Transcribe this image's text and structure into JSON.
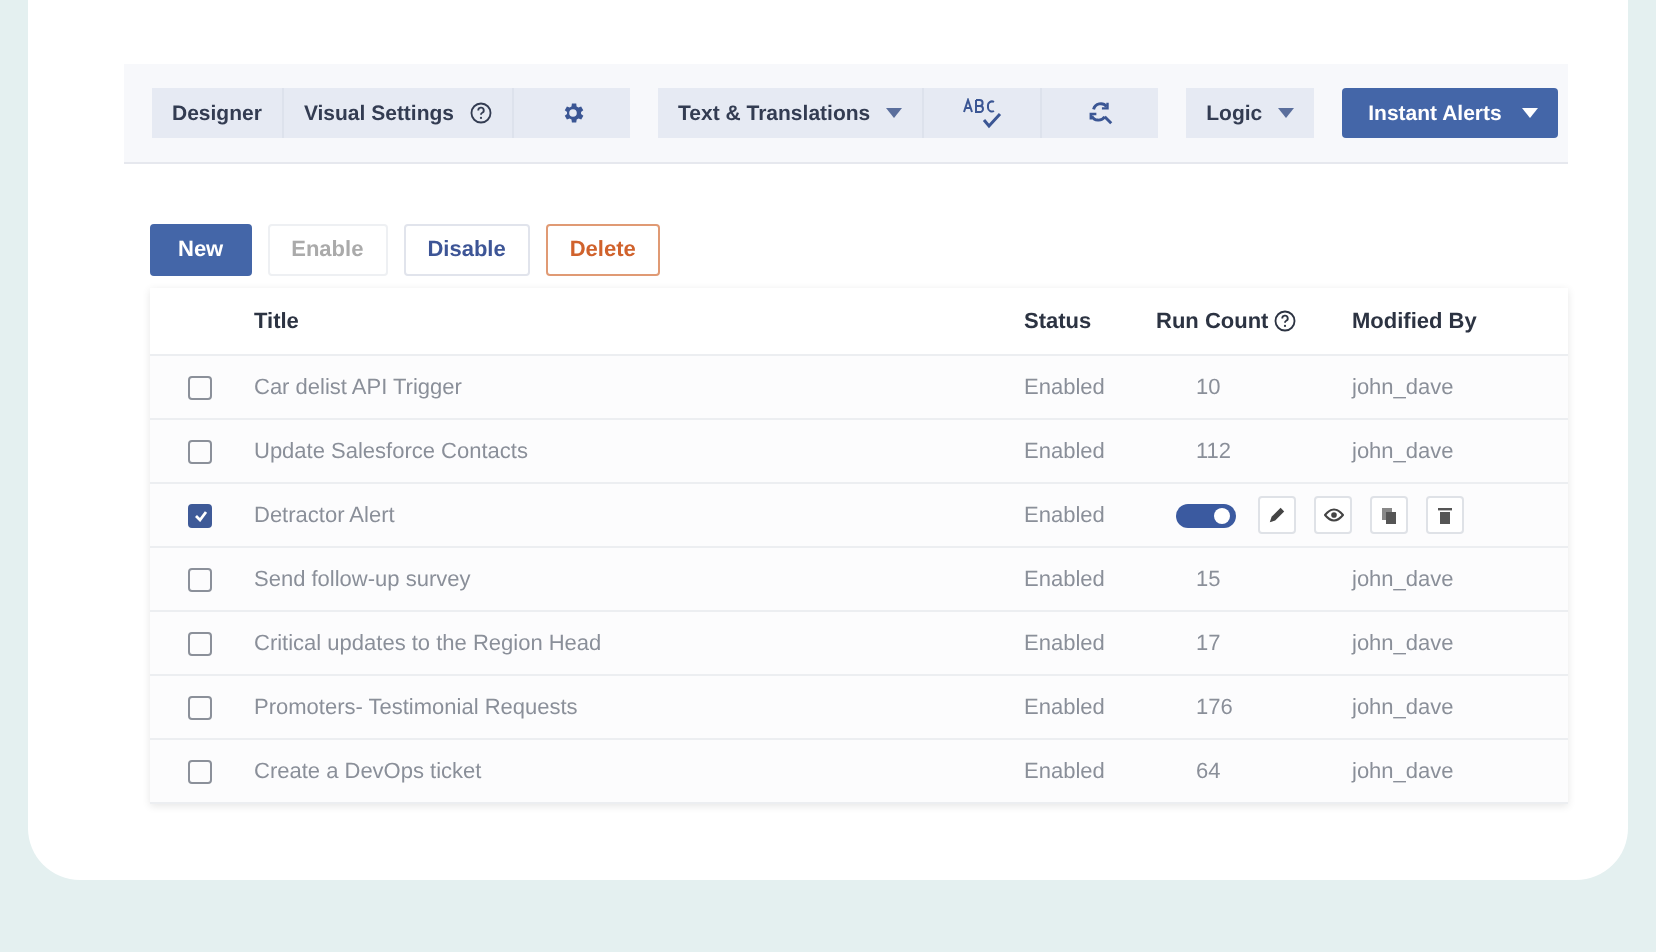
{
  "toolbar": {
    "groups": [
      {
        "items": [
          {
            "label": "Designer",
            "kind": "text"
          },
          {
            "label": "Visual Settings",
            "kind": "help"
          },
          {
            "kind": "gear"
          }
        ]
      },
      {
        "items": [
          {
            "label": "Text & Translations",
            "kind": "dropdown"
          },
          {
            "kind": "spellcheck"
          },
          {
            "kind": "find"
          }
        ]
      },
      {
        "items": [
          {
            "label": "Logic",
            "kind": "dropdown"
          }
        ]
      },
      {
        "items": [
          {
            "label": "Instant Alerts",
            "kind": "primary-dropdown"
          }
        ]
      }
    ]
  },
  "actions": [
    {
      "label": "New",
      "kind": "primary",
      "disabled": false
    },
    {
      "label": "Enable",
      "kind": "plain",
      "disabled": true
    },
    {
      "label": "Disable",
      "kind": "plain",
      "disabled": false
    },
    {
      "label": "Delete",
      "kind": "danger",
      "disabled": false
    }
  ],
  "table": {
    "columns": [
      {
        "label": "Title",
        "help": false
      },
      {
        "label": "Status",
        "help": false
      },
      {
        "label": "Run Count",
        "help": true
      },
      {
        "label": "Modified By",
        "help": false
      }
    ],
    "rows": [
      {
        "title": "Car delist API Trigger",
        "status": "Enabled",
        "run_count": "10",
        "modified_by": "john_dave",
        "checked": false,
        "kind": "plain"
      },
      {
        "title": "Update Salesforce Contacts",
        "status": "Enabled",
        "run_count": "112",
        "modified_by": "john_dave",
        "checked": false,
        "kind": "plain"
      },
      {
        "title": "Detractor Alert",
        "status": "Enabled",
        "checked": true,
        "kind": "actions",
        "toggle_on": true
      },
      {
        "title": "Send follow-up survey",
        "status": "Enabled",
        "run_count": "15",
        "modified_by": "john_dave",
        "checked": false,
        "kind": "plain"
      },
      {
        "title": "Critical updates to the Region Head",
        "status": "Enabled",
        "run_count": "17",
        "modified_by": "john_dave",
        "checked": false,
        "kind": "plain"
      },
      {
        "title": "Promoters- Testimonial Requests",
        "status": "Enabled",
        "run_count": "176",
        "modified_by": "john_dave",
        "checked": false,
        "kind": "plain"
      },
      {
        "title": "Create a DevOps ticket",
        "status": "Enabled",
        "run_count": "64",
        "modified_by": "john_dave",
        "checked": false,
        "kind": "plain"
      }
    ]
  }
}
